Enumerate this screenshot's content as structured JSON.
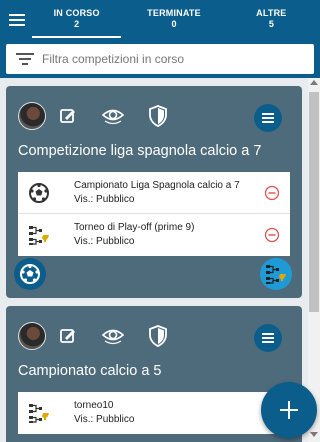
{
  "header": {
    "menu_icon": "hamburger-menu-icon",
    "tabs": [
      {
        "label": "IN CORSO",
        "count": "2",
        "active": true
      },
      {
        "label": "TERMINATE",
        "count": "0",
        "active": false
      },
      {
        "label": "ALTRE",
        "count": "5",
        "active": false
      }
    ]
  },
  "search": {
    "placeholder": "Filtra competizioni in corso",
    "icon": "filter-icon"
  },
  "competitions": [
    {
      "title": "Competizione liga spagnola calcio a 7",
      "items": [
        {
          "name": "Campionato Liga Spagnola calcio a 7",
          "visibility": "Vis.: Pubblico",
          "icon": "soccer-ball-icon"
        },
        {
          "name": "Torneo di Play-off (prime 9)",
          "visibility": "Vis.: Pubblico",
          "icon": "bracket-trophy-icon"
        }
      ]
    },
    {
      "title": "Campionato calcio a 5",
      "items": [
        {
          "name": "torneo10",
          "visibility": "Vis.: Pubblico",
          "icon": "bracket-trophy-icon"
        }
      ]
    }
  ],
  "colors": {
    "primary": "#0b5d8c",
    "card": "#4e6b7c",
    "accent": "#1e9bd7",
    "remove": "#d9534f"
  },
  "fab": {
    "icon": "plus-icon"
  }
}
